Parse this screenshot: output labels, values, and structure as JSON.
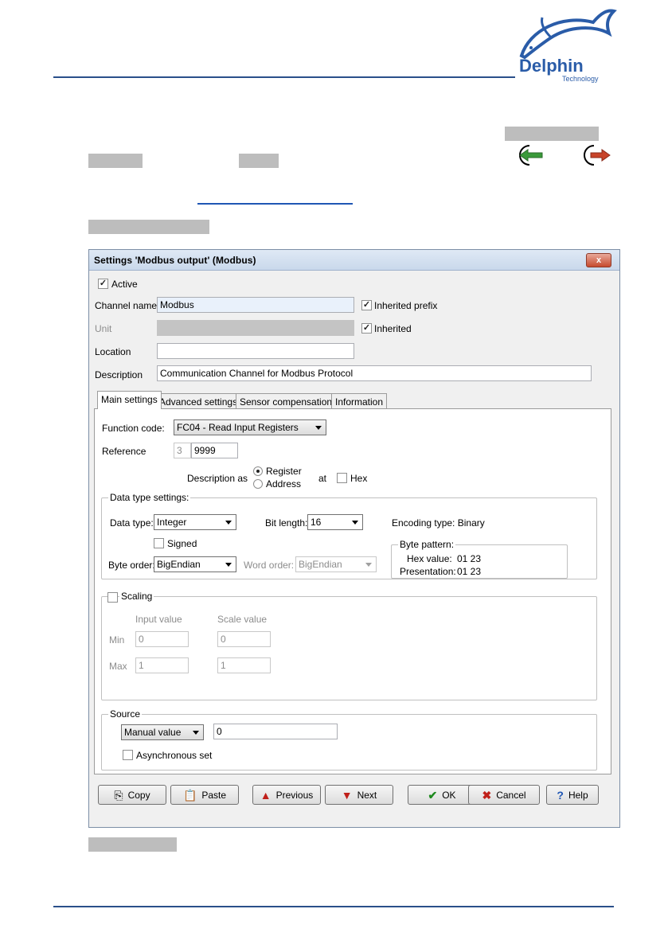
{
  "logo": {
    "brand": "Delphin",
    "sub": "Technology"
  },
  "dialog": {
    "title": "Settings 'Modbus output' (Modbus)",
    "close_label": "x",
    "active_label": "Active",
    "channel_name_label": "Channel name",
    "channel_name_value": "Modbus",
    "inherited_prefix_label": "Inherited prefix",
    "unit_label": "Unit",
    "unit_value": "",
    "inherited_label": "Inherited",
    "location_label": "Location",
    "location_value": "",
    "description_label": "Description",
    "description_value": "Communication Channel for Modbus Protocol",
    "tabs": [
      {
        "label": "Main settings"
      },
      {
        "label": "Advanced settings"
      },
      {
        "label": "Sensor compensation"
      },
      {
        "label": "Information"
      }
    ],
    "main": {
      "function_code_label": "Function code:",
      "function_code_value": "FC04 - Read Input Registers",
      "reference_label": "Reference",
      "reference_prefix": "3",
      "reference_value": "9999",
      "description_as_label": "Description as",
      "register_label": "Register",
      "address_label": "Address",
      "at_label": "at",
      "hex_label": "Hex",
      "datatype_group": "Data type settings:",
      "data_type_label": "Data type:",
      "data_type_value": "Integer",
      "bit_length_label": "Bit length:",
      "bit_length_value": "16",
      "encoding_type": "Encoding type: Binary",
      "signed_label": "Signed",
      "byte_order_label": "Byte order:",
      "byte_order_value": "BigEndian",
      "word_order_label": "Word order:",
      "word_order_value": "BigEndian",
      "byte_pattern_group": "Byte pattern:",
      "hex_value_label": "Hex value:",
      "hex_value": "01 23",
      "presentation_label": "Presentation:",
      "presentation_value": "01 23",
      "scaling_label": "Scaling",
      "input_value_label": "Input value",
      "scale_value_label": "Scale value",
      "min_label": "Min",
      "max_label": "Max",
      "min_input": "0",
      "min_scale": "0",
      "max_input": "1",
      "max_scale": "1",
      "source_group": "Source",
      "source_value": "Manual value",
      "source_input": "0",
      "async_label": "Asynchronous set"
    },
    "buttons": {
      "copy": "Copy",
      "paste": "Paste",
      "previous": "Previous",
      "next": "Next",
      "ok": "OK",
      "cancel": "Cancel",
      "help": "Help"
    }
  },
  "colors": {
    "accent": "#2a4f8a",
    "link": "#1f56b4",
    "highlight": "#bdbdbd"
  }
}
